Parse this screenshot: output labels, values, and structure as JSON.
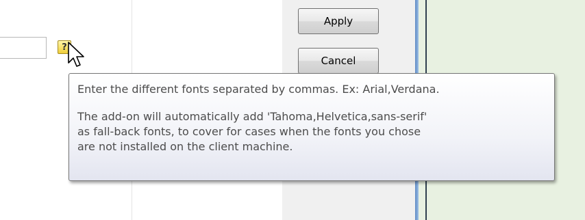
{
  "settings": {
    "fonts_input_value": "",
    "help_button_label": "?"
  },
  "buttons": {
    "apply_label": "Apply",
    "cancel_label": "Cancel"
  },
  "tooltip": {
    "line1": "Enter the different fonts separated by commas. Ex: Arial,Verdana.",
    "line2": "The add-on will automatically add 'Tahoma,Helvetica,sans-serif'",
    "line3": "as fall-back fonts, to cover for cases when the fonts you chose",
    "line4": "are not installed on the client machine."
  },
  "icons": {
    "cursor": "arrow-cursor-icon",
    "help": "help-icon"
  }
}
